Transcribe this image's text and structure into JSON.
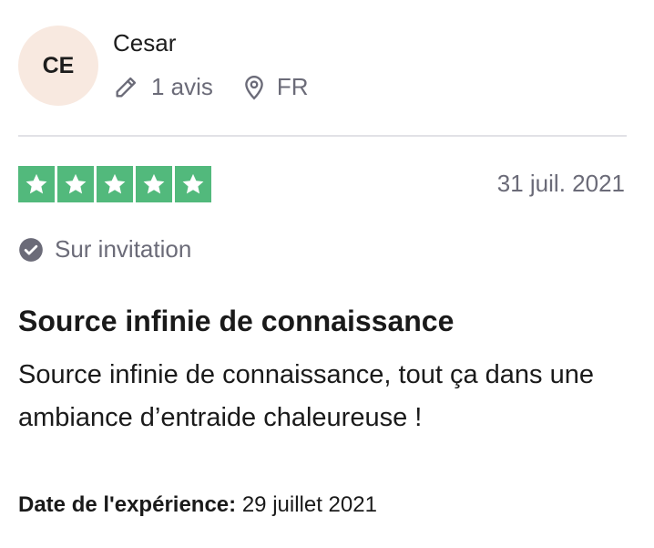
{
  "reviewer": {
    "initials": "CE",
    "name": "Cesar",
    "review_count": "1 avis",
    "country": "FR",
    "avatar_bg": "#f8e9e0"
  },
  "rating": {
    "stars": 5,
    "max": 5,
    "star_color": "#52b97c"
  },
  "review": {
    "date": "31 juil. 2021",
    "verification": "Sur invitation",
    "title": "Source infinie de connaissance",
    "text": "Source infinie de connaissance, tout ça dans une ambiance d’entraide chaleureuse !",
    "experience_label": "Date de l'expérience:",
    "experience_date": "29 juillet 2021"
  },
  "icons": {
    "reviews": "pencil-icon",
    "location": "location-pin-icon",
    "verification": "check-circle-icon",
    "star": "star-icon"
  }
}
